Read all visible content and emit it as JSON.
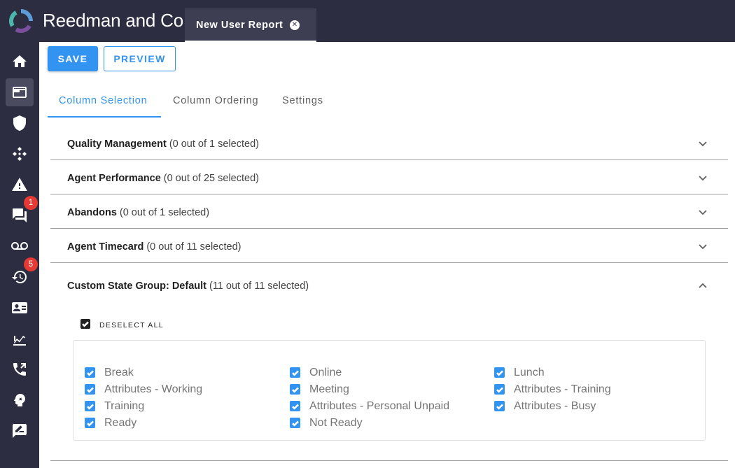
{
  "app": {
    "title": "Reedman and Co"
  },
  "open_tab": {
    "label": "New User Report",
    "close_icon": "close-circle-icon"
  },
  "sidebar": {
    "items": [
      {
        "name": "home",
        "icon": "home-icon",
        "active": false
      },
      {
        "name": "reports",
        "icon": "window-icon",
        "active": true
      },
      {
        "name": "security",
        "icon": "shield-icon",
        "active": false
      },
      {
        "name": "routing",
        "icon": "diamond-arrows-icon",
        "active": false
      },
      {
        "name": "alerts",
        "icon": "warning-icon",
        "active": false
      },
      {
        "name": "chat",
        "icon": "chat-icon",
        "active": false,
        "badge": "1"
      },
      {
        "name": "voicemail",
        "icon": "voicemail-icon",
        "active": false
      },
      {
        "name": "history",
        "icon": "history-icon",
        "active": false,
        "badge": "5"
      },
      {
        "name": "contacts",
        "icon": "contact-card-icon",
        "active": false
      },
      {
        "name": "analytics",
        "icon": "chart-icon",
        "active": false
      },
      {
        "name": "calls",
        "icon": "phone-forward-icon",
        "active": false
      },
      {
        "name": "ai",
        "icon": "brain-icon",
        "active": false
      },
      {
        "name": "feedback",
        "icon": "feedback-icon",
        "active": false
      }
    ]
  },
  "toolbar": {
    "save_label": "SAVE",
    "preview_label": "PREVIEW"
  },
  "tabs": [
    {
      "label": "Column Selection",
      "active": true
    },
    {
      "label": "Column Ordering",
      "active": false
    },
    {
      "label": "Settings",
      "active": false
    }
  ],
  "sections": [
    {
      "title": "Quality Management",
      "count": "(0 out of 1 selected)",
      "expanded": false
    },
    {
      "title": "Agent Performance",
      "count": "(0 out of 25 selected)",
      "expanded": false
    },
    {
      "title": "Abandons",
      "count": "(0 out of 1 selected)",
      "expanded": false
    },
    {
      "title": "Agent Timecard",
      "count": "(0 out of 11 selected)",
      "expanded": false
    },
    {
      "title": "Custom State Group: Default",
      "count": "(11 out of 11 selected)",
      "expanded": true
    }
  ],
  "expanded_section": {
    "deselect_label": "DESELECT ALL",
    "options": [
      {
        "label": "Break",
        "checked": true
      },
      {
        "label": "Online",
        "checked": true
      },
      {
        "label": "Lunch",
        "checked": true
      },
      {
        "label": "Attributes - Working",
        "checked": true
      },
      {
        "label": "Meeting",
        "checked": true
      },
      {
        "label": "Attributes - Training",
        "checked": true
      },
      {
        "label": "Training",
        "checked": true
      },
      {
        "label": "Attributes - Personal Unpaid",
        "checked": true
      },
      {
        "label": "Attributes - Busy",
        "checked": true
      },
      {
        "label": "Ready",
        "checked": true
      },
      {
        "label": "Not Ready",
        "checked": true
      }
    ]
  },
  "colors": {
    "accent": "#3393f0",
    "chrome": "#2c2d40",
    "badge": "#e53935"
  }
}
